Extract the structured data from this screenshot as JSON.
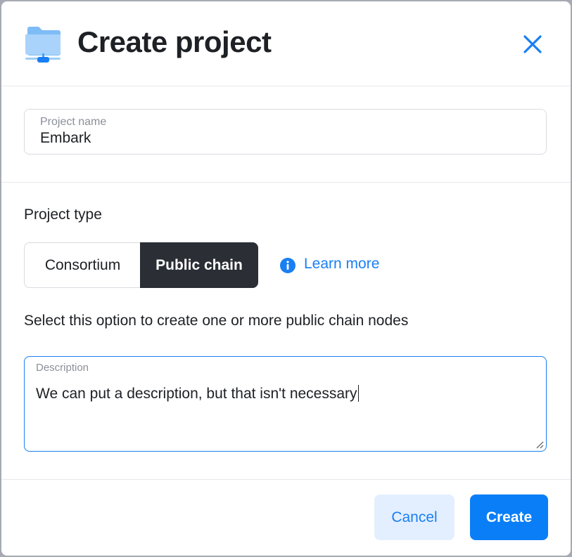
{
  "dialog": {
    "title": "Create project",
    "icon": "folder-network-icon",
    "close_icon": "close-icon"
  },
  "project_name": {
    "label": "Project name",
    "value": "Embark"
  },
  "project_type": {
    "label": "Project type",
    "options": [
      "Consortium",
      "Public chain"
    ],
    "selected": "Public chain",
    "learn_more": "Learn more",
    "helper": "Select this option to create one or more public chain nodes"
  },
  "description": {
    "label": "Description",
    "value": "We can put a description, but that isn't necessary"
  },
  "footer": {
    "cancel_label": "Cancel",
    "create_label": "Create"
  },
  "colors": {
    "accent": "#0a7ef7",
    "link": "#1a7ff2",
    "selected_segment": "#2b2f35",
    "cancel_bg": "#e3efff"
  }
}
